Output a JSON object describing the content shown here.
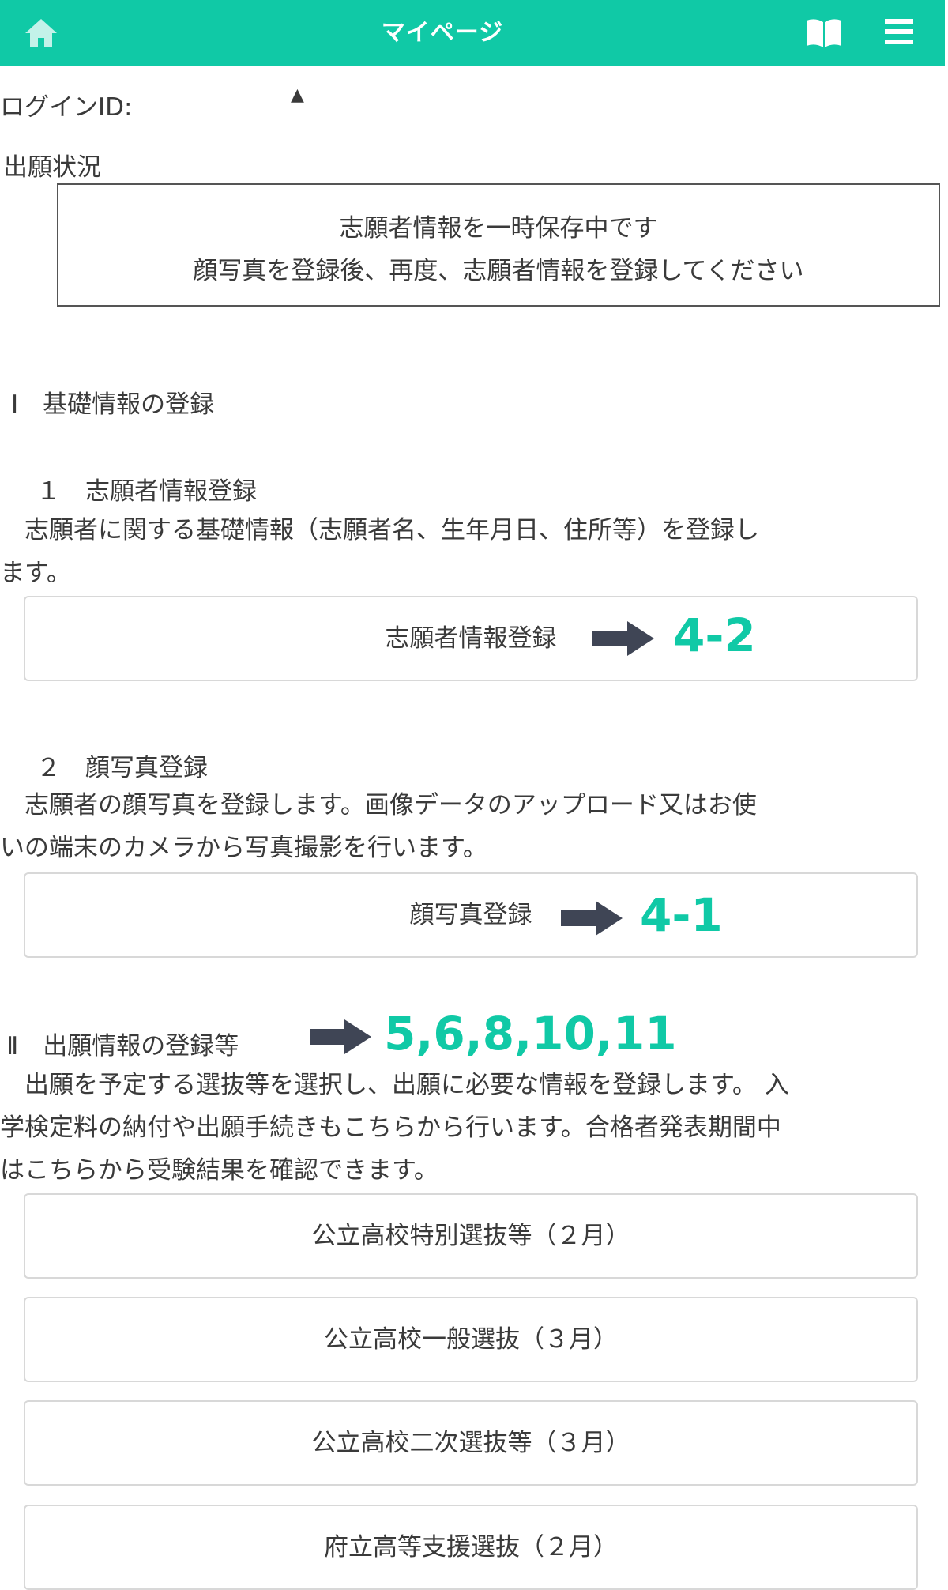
{
  "header": {
    "title": "マイページ",
    "home_icon": "home-icon",
    "guide_icon": "book-icon",
    "menu_icon": "hamburger-menu-icon",
    "color": "#10c9a6"
  },
  "login": {
    "label": "ログインID:",
    "value": "▲"
  },
  "status": {
    "heading": "出願状況",
    "line1": "志願者情報を一時保存中です",
    "line2": "顔写真を登録後、再度、志願者情報を登録してください"
  },
  "section1": {
    "heading": "Ⅰ　基礎情報の登録",
    "item1": {
      "heading": "１　志願者情報登録",
      "desc_line1": "　志願者に関する基礎情報（志願者名、生年月日、住所等）を登録し",
      "desc_line2": "ます。",
      "button": "志願者情報登録",
      "annotation": "4-2"
    },
    "item2": {
      "heading": "２　顔写真登録",
      "desc_line1": "　志願者の顔写真を登録します。画像データのアップロード又はお使",
      "desc_line2": "いの端末のカメラから写真撮影を行います。",
      "button": "顔写真登録",
      "annotation": "4-1"
    }
  },
  "section2": {
    "heading": "Ⅱ　出願情報の登録等",
    "annotation": "5,6,8,10,11",
    "desc_line1": "　出願を予定する選抜等を選択し、出願に必要な情報を登録します。 入",
    "desc_line2": "学検定料の納付や出願手続きもこちらから行います。合格者発表期間中",
    "desc_line3": "はこちらから受験結果を確認できます。",
    "buttons": [
      "公立高校特別選抜等（２月）",
      "公立高校一般選抜（３月）",
      "公立高校二次選抜等（３月）",
      "府立高等支援選抜（２月）"
    ]
  }
}
